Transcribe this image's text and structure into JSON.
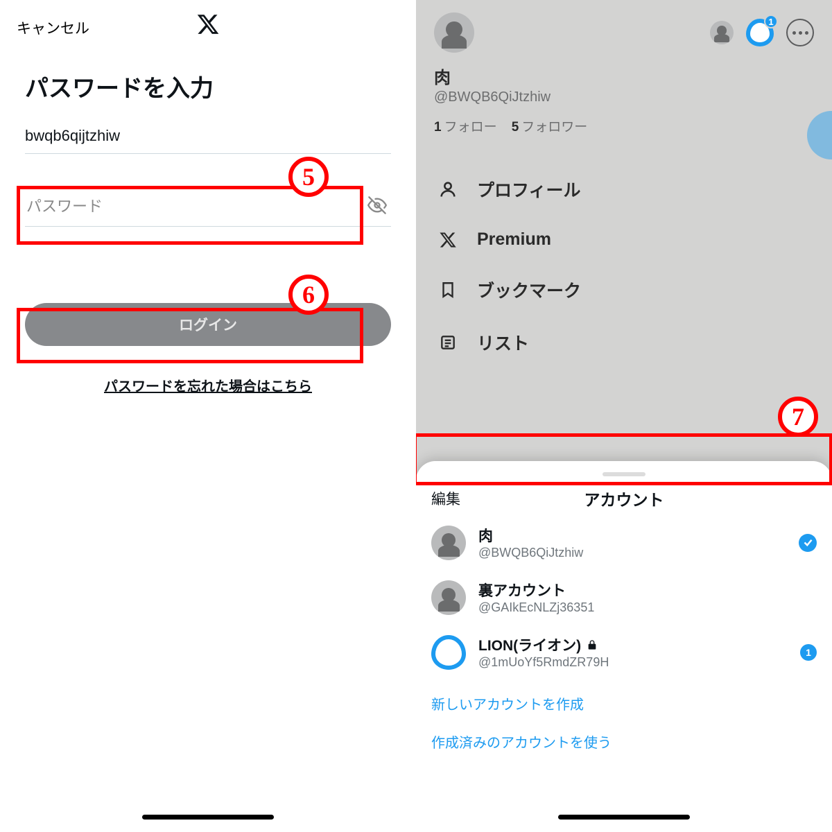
{
  "left": {
    "cancel": "キャンセル",
    "title": "パスワードを入力",
    "username_value": "bwqb6qijtzhiw",
    "password_placeholder": "パスワード",
    "login_label": "ログイン",
    "forgot_label": "パスワードを忘れた場合はこちら"
  },
  "right": {
    "profile_name": "肉",
    "profile_handle": "@BWQB6QiJtzhiw",
    "following_count": "1",
    "following_label": "フォロー",
    "followers_count": "5",
    "followers_label": "フォロワー",
    "egg_badge": "1",
    "menu": [
      {
        "label": "プロフィール",
        "icon": "person"
      },
      {
        "label": "Premium",
        "icon": "x"
      },
      {
        "label": "ブックマーク",
        "icon": "bookmark"
      },
      {
        "label": "リスト",
        "icon": "list"
      }
    ]
  },
  "sheet": {
    "edit": "編集",
    "title": "アカウント",
    "accounts": [
      {
        "name": "肉",
        "handle": "@BWQB6QiJtzhiw",
        "selected": true
      },
      {
        "name": "裏アカウント",
        "handle": "@GAIkEcNLZj36351"
      },
      {
        "name": "LION(ライオン)",
        "handle": "@1mUoYf5RmdZR79H",
        "locked": true,
        "badge": "1",
        "egg": true
      }
    ],
    "create_new": "新しいアカウントを作成",
    "use_existing": "作成済みのアカウントを使う"
  },
  "annotations": {
    "5": "5",
    "6": "6",
    "7": "7"
  }
}
